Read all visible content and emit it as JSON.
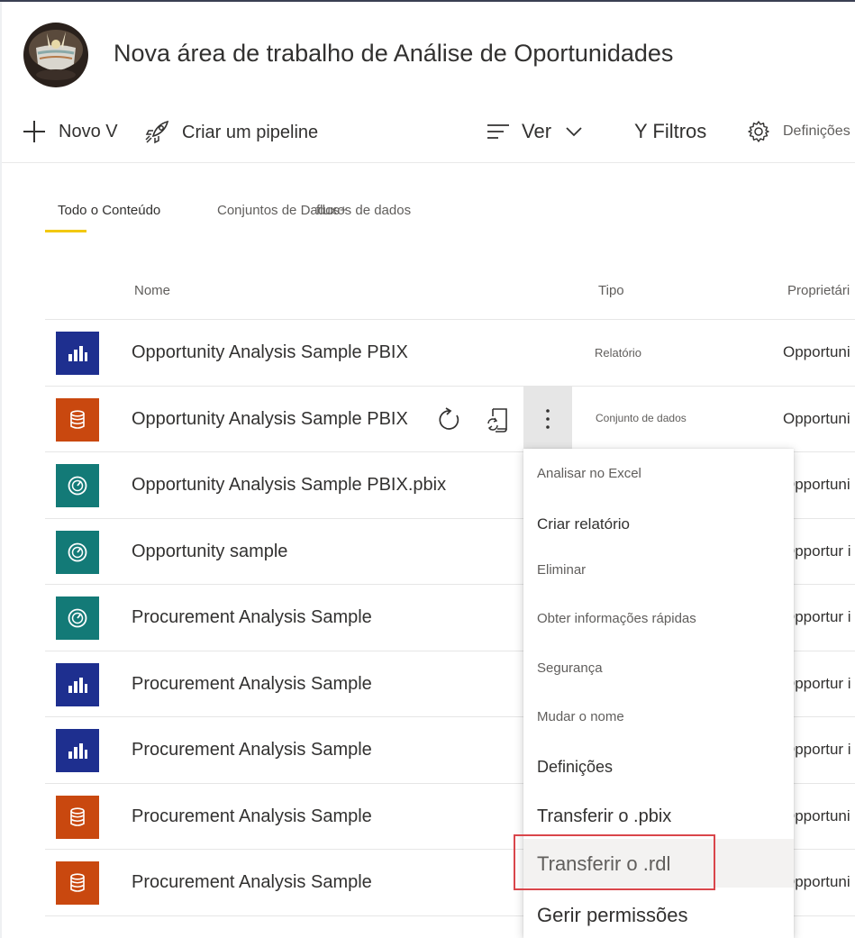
{
  "workspace": {
    "title": "Nova área de trabalho de Análise de Oportunidades"
  },
  "toolbar": {
    "new_label": "Novo V",
    "pipeline_label": "Criar um pipeline",
    "view_label": "Ver",
    "filters_label": "Y Filtros",
    "settings_label": "Definições"
  },
  "tabs": {
    "all": "Todo o Conteúdo",
    "datasets": "Conjuntos de Dados+",
    "dataflows": "fluxos de dados"
  },
  "columns": {
    "name": "Nome",
    "type": "Tipo",
    "owner": "Proprietári"
  },
  "rows": [
    {
      "icon": "report-icon",
      "name": "Opportunity Analysis Sample PBIX",
      "type": "Relatório",
      "owner": "Opportuni"
    },
    {
      "icon": "dataset-icon",
      "name": "Opportunity Analysis Sample PBIX",
      "type": "Conjunto de dados",
      "owner": "Opportuni"
    },
    {
      "icon": "dashboard-icon",
      "name": "Opportunity Analysis Sample PBIX.pbix",
      "type": "",
      "owner": "Opportuni"
    },
    {
      "icon": "dashboard-icon",
      "name": "Opportunity sample",
      "type": "",
      "owner": "Opportur i"
    },
    {
      "icon": "dashboard-icon",
      "name": "Procurement Analysis Sample",
      "type": "",
      "owner": "Opportur i"
    },
    {
      "icon": "report-icon",
      "name": "Procurement Analysis Sample",
      "type": "",
      "owner": "Opportur i"
    },
    {
      "icon": "report-icon",
      "name": "Procurement Analysis Sample",
      "type": "",
      "owner": "Opportur i"
    },
    {
      "icon": "dataset-icon",
      "name": "Procurement Analysis Sample",
      "type": "",
      "owner": "Opportuni"
    },
    {
      "icon": "dataset-icon",
      "name": "Procurement Analysis Sample",
      "type": "",
      "owner": "Opportuni"
    }
  ],
  "context_menu": {
    "items": [
      "Analisar no Excel",
      "Criar relatório",
      "Eliminar",
      "Obter informações rápidas",
      "Segurança",
      "Mudar o nome",
      "Definições",
      "Transferir o .pbix",
      "Transferir o .rdl",
      "Gerir permissões"
    ],
    "highlighted": "Transferir o .rdl"
  },
  "colors": {
    "report": "#1e2f8f",
    "dataset": "#c9480f",
    "dashboard": "#137a77",
    "tab_accent": "#f2c811",
    "highlight_box": "#d9464b"
  }
}
